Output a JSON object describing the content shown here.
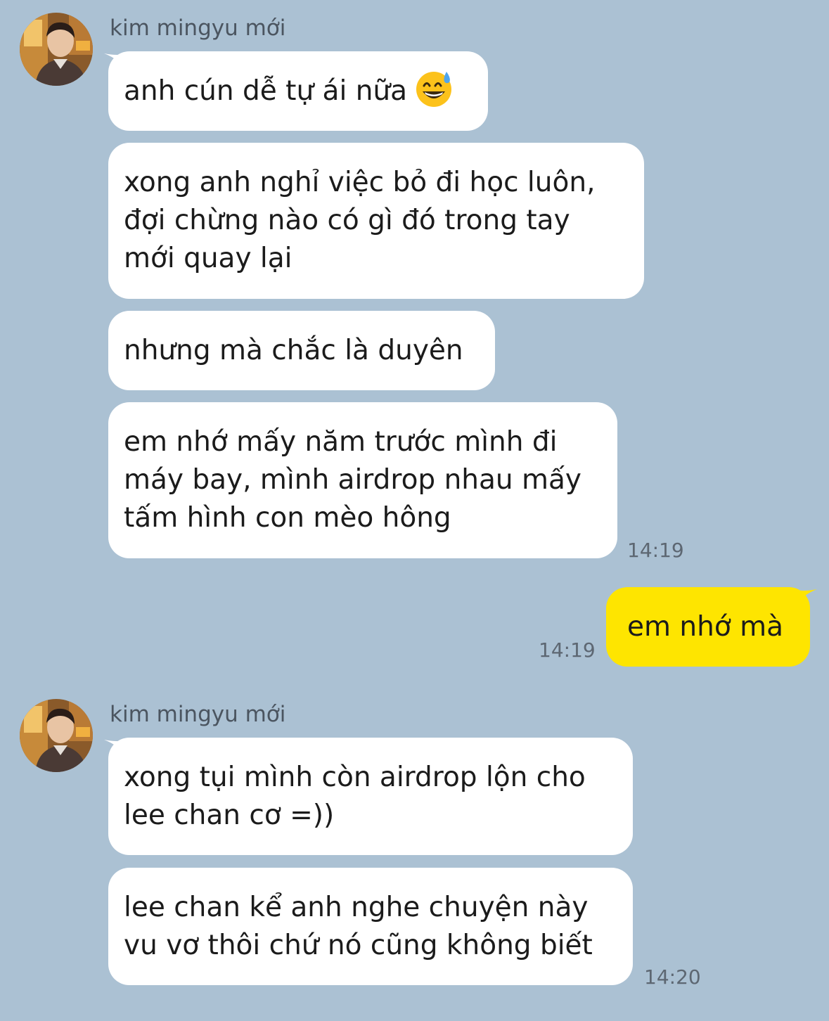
{
  "chat": {
    "messages": [
      {
        "sender": "kim mingyu mới",
        "bubbles": [
          {
            "text": "anh cún dễ tự ái nữa",
            "emoji": "grinning-face-with-sweat-icon"
          },
          {
            "text": "xong anh nghỉ việc bỏ đi học luôn,\nđợi chừng nào có gì đó trong tay\nmới quay lại"
          },
          {
            "text": "nhưng mà chắc là duyên"
          },
          {
            "text": "em nhớ mấy năm trước mình đi\nmáy bay, mình airdrop nhau mấy\ntấm hình con mèo hông"
          }
        ],
        "time": "14:19"
      },
      {
        "sender": "me",
        "bubbles": [
          {
            "text": "em nhớ mà"
          }
        ],
        "time": "14:19"
      },
      {
        "sender": "kim mingyu mới",
        "bubbles": [
          {
            "text": "xong tụi mình còn airdrop lộn cho\nlee chan cơ =))"
          },
          {
            "text": "lee chan kể anh nghe chuyện này\nvu vơ thôi chứ nó cũng không biết"
          }
        ],
        "time": "14:20"
      }
    ]
  },
  "colors": {
    "background": "#abc1d3",
    "incoming_bubble": "#ffffff",
    "outgoing_bubble": "#fee500"
  }
}
